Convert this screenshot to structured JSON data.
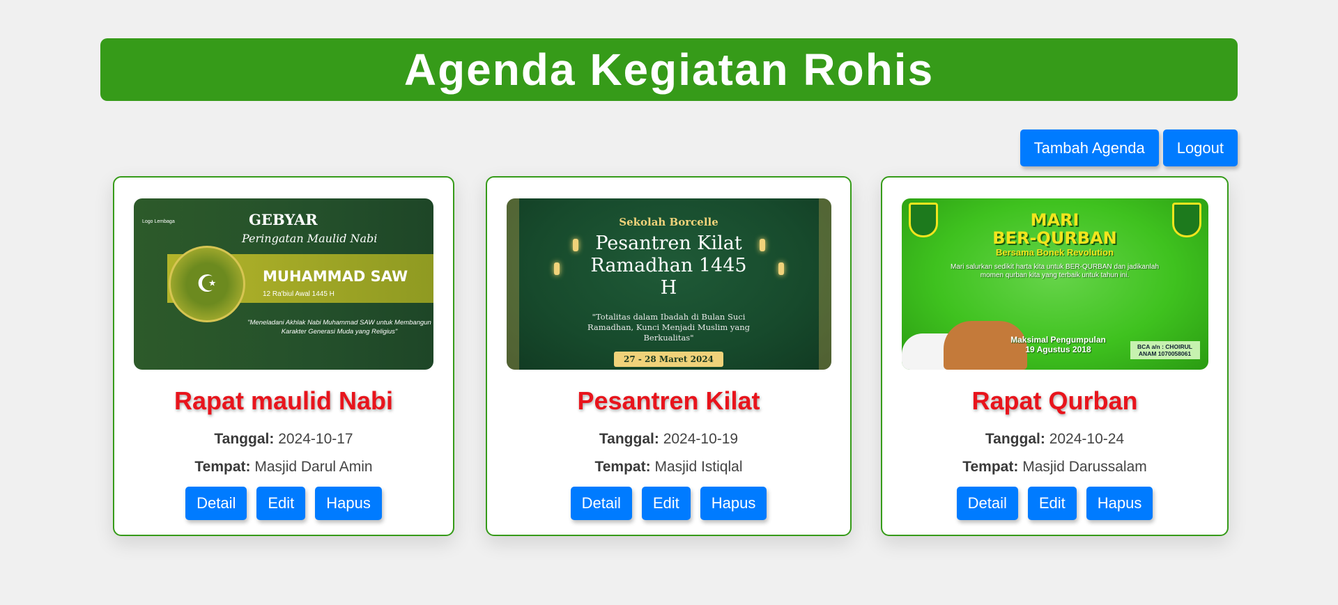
{
  "header": {
    "title": "Agenda Kegiatan Rohis"
  },
  "top_actions": {
    "add_label": "Tambah Agenda",
    "logout_label": "Logout"
  },
  "labels": {
    "date": "Tanggal:",
    "place": "Tempat:",
    "detail": "Detail",
    "edit": "Edit",
    "delete": "Hapus"
  },
  "colors": {
    "header_bg": "#369b19",
    "button_bg": "#007bff",
    "title_red": "#e8141c",
    "card_border": "#369b19"
  },
  "cards": [
    {
      "title": "Rapat maulid Nabi",
      "date": "2024-10-17",
      "place": "Masjid Darul Amin",
      "poster": {
        "logo": "Logo Lembaga",
        "heading": "GEBYAR",
        "subheading": "Peringatan Maulid Nabi",
        "main": "MUHAMMAD SAW",
        "date_line": "12 Ra'biul Awal 1445 H",
        "quote": "\"Meneladani Akhlak Nabi Muhammad SAW untuk Membangun Karakter Generasi Muda yang Religius\""
      }
    },
    {
      "title": "Pesantren Kilat",
      "date": "2024-10-19",
      "place": "Masjid Istiqlal",
      "poster": {
        "org": "Sekolah Borcelle",
        "main": "Pesantren Kilat Ramadhan 1445 H",
        "quote": "\"Totalitas dalam Ibadah di Bulan Suci Ramadhan, Kunci Menjadi Muslim yang Berkualitas\"",
        "date_pill": "27 - 28 Maret 2024"
      }
    },
    {
      "title": "Rapat Qurban",
      "date": "2024-10-24",
      "place": "Masjid Darussalam",
      "poster": {
        "main1": "MARI",
        "main2": "BER-QURBAN",
        "sub": "Bersama Bonek Revolution",
        "body": "Mari salurkan sedikit harta kita untuk BER-QURBAN dan jadikanlah momen qurban kita yang terbaik untuk tahun ini.",
        "deadline": "Maksimal Pengumpulan 19 Agustus 2018",
        "bank": "BCA a/n : CHOIRUL ANAM 1070058061"
      }
    }
  ]
}
